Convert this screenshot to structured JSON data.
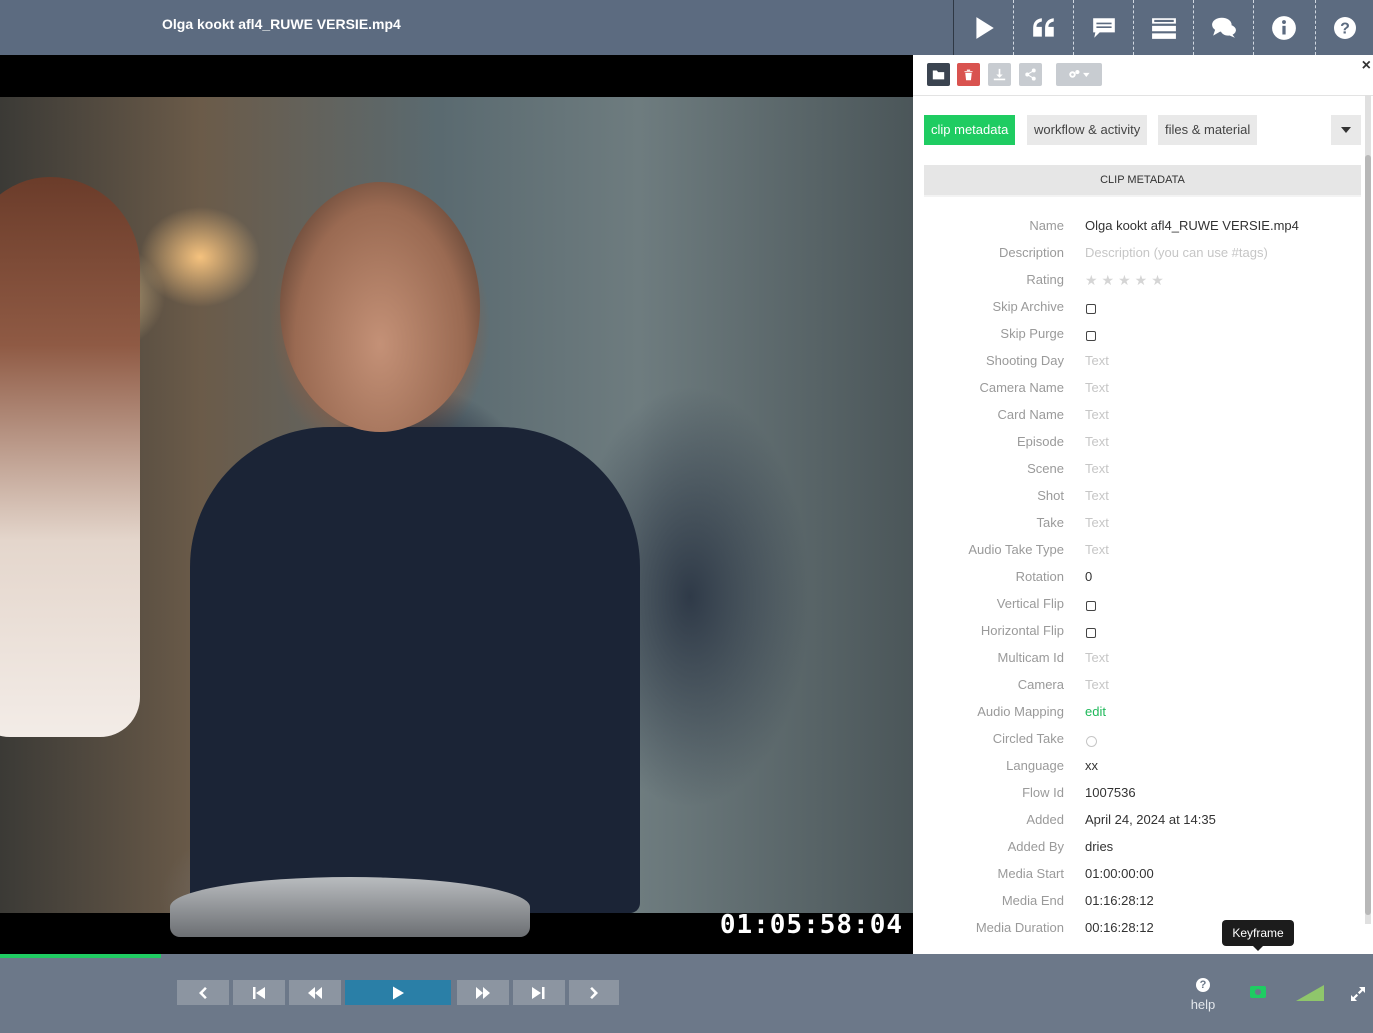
{
  "header": {
    "title": "Olga kookt afl4_RUWE VERSIE.mp4",
    "buttons": [
      {
        "icon": "play-icon"
      },
      {
        "icon": "quote-icon"
      },
      {
        "icon": "comment-icon"
      },
      {
        "icon": "list-icon"
      },
      {
        "icon": "chat-icon"
      },
      {
        "icon": "info-icon"
      }
    ],
    "help_icon": "question-icon"
  },
  "player": {
    "timecode": "01:05:58:04",
    "progress_fraction": 0.117
  },
  "panel": {
    "toolbar_icons": [
      "folder-icon",
      "trash-icon",
      "download-icon",
      "share-icon",
      "settings-icon"
    ],
    "close_label": "×",
    "tabs": [
      {
        "label": "clip metadata",
        "active": true
      },
      {
        "label": "workflow & activity",
        "active": false
      },
      {
        "label": "files & material",
        "active": false
      }
    ],
    "section_title": "CLIP METADATA",
    "fields": [
      {
        "label": "Name",
        "value": "Olga kookt afl4_RUWE VERSIE.mp4",
        "type": "text"
      },
      {
        "label": "Description",
        "value": "Description (you can use #tags)",
        "type": "placeholder"
      },
      {
        "label": "Rating",
        "value": "★★★★★",
        "type": "stars",
        "rating": 0
      },
      {
        "label": "Skip Archive",
        "value": "",
        "type": "checkbox"
      },
      {
        "label": "Skip Purge",
        "value": "",
        "type": "checkbox"
      },
      {
        "label": "Shooting Day",
        "value": "Text",
        "type": "placeholder"
      },
      {
        "label": "Camera Name",
        "value": "Text",
        "type": "placeholder"
      },
      {
        "label": "Card Name",
        "value": "Text",
        "type": "placeholder"
      },
      {
        "label": "Episode",
        "value": "Text",
        "type": "placeholder"
      },
      {
        "label": "Scene",
        "value": "Text",
        "type": "placeholder"
      },
      {
        "label": "Shot",
        "value": "Text",
        "type": "placeholder"
      },
      {
        "label": "Take",
        "value": "Text",
        "type": "placeholder"
      },
      {
        "label": "Audio Take Type",
        "value": "Text",
        "type": "placeholder"
      },
      {
        "label": "Rotation",
        "value": "0",
        "type": "text"
      },
      {
        "label": "Vertical Flip",
        "value": "",
        "type": "checkbox"
      },
      {
        "label": "Horizontal Flip",
        "value": "",
        "type": "checkbox"
      },
      {
        "label": "Multicam Id",
        "value": "Text",
        "type": "placeholder"
      },
      {
        "label": "Camera",
        "value": "Text",
        "type": "placeholder"
      },
      {
        "label": "Audio Mapping",
        "value": "edit",
        "type": "link"
      },
      {
        "label": "Circled Take",
        "value": "",
        "type": "circle"
      },
      {
        "label": "Language",
        "value": "xx",
        "type": "text"
      },
      {
        "label": "Flow Id",
        "value": "1007536",
        "type": "text"
      },
      {
        "label": "Added",
        "value": "April 24, 2024 at 14:35",
        "type": "text"
      },
      {
        "label": "Added By",
        "value": "dries",
        "type": "text"
      },
      {
        "label": "Media Start",
        "value": "01:00:00:00",
        "type": "text"
      },
      {
        "label": "Media End",
        "value": "01:16:28:12",
        "type": "text"
      },
      {
        "label": "Media Duration",
        "value": "00:16:28:12",
        "type": "text"
      }
    ]
  },
  "controls": {
    "help_label": "help",
    "tooltip": "Keyframe",
    "buttons": [
      "prev-icon",
      "skip-start-icon",
      "rewind-icon",
      "play-icon",
      "fast-forward-icon",
      "skip-end-icon",
      "next-icon"
    ]
  },
  "colors": {
    "accent": "#1fcc62",
    "topbar": "#5c6b80",
    "bottombar": "#6c7889",
    "play_button": "#2a7fa7",
    "delete_button": "#d9534f"
  }
}
